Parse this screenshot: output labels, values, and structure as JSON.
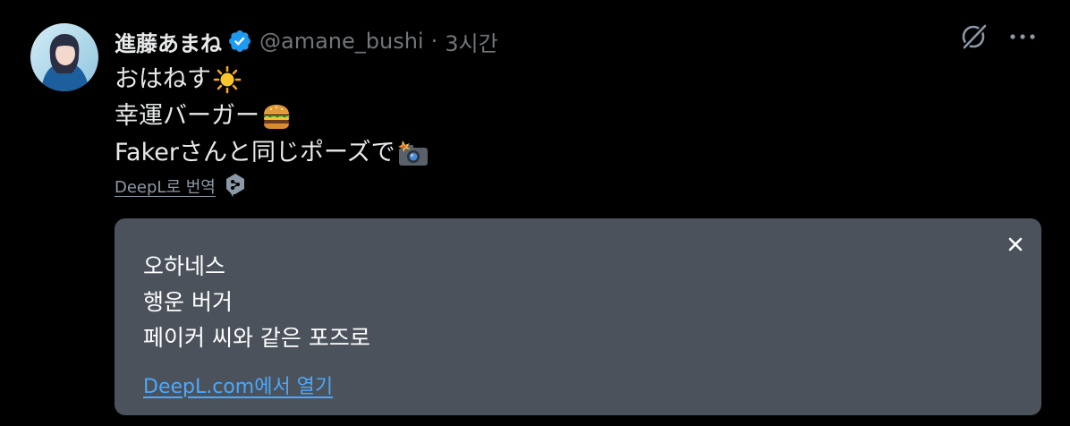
{
  "tweet": {
    "display_name": "進藤あまね",
    "handle": "@amane_bushi",
    "separator": "·",
    "time": "3시간",
    "lines": [
      "おはねす",
      "幸運バーガー",
      "Fakerさんと同じポーズで"
    ],
    "line_emojis": [
      "sun-emoji",
      "burger-emoji",
      "camera-flash-emoji"
    ],
    "translate_link": "DeepL로 번역"
  },
  "translation": {
    "lines": [
      "오하네스",
      "행운 버거",
      "페이커 씨와 같은 포즈로"
    ],
    "open_link": "DeepL.com에서 열기"
  },
  "colors": {
    "background": "#000000",
    "text_primary": "#e7e9ea",
    "text_secondary": "#71767b",
    "verified_blue": "#1d9bf0",
    "card_bg": "#4b525b",
    "link_blue": "#4aa8ff"
  }
}
